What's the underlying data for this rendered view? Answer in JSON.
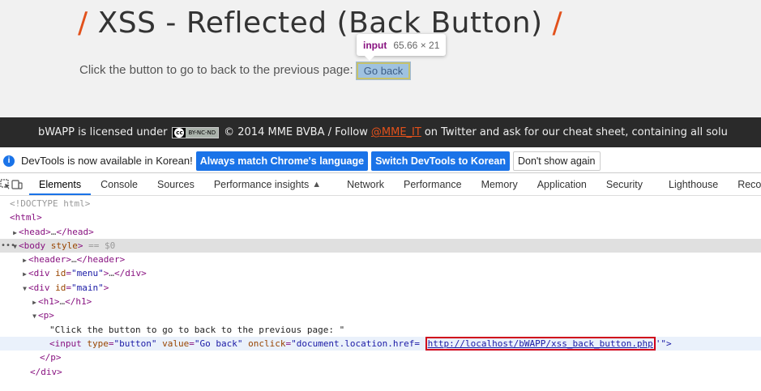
{
  "page": {
    "title": "XSS - Reflected (Back Button)",
    "title_slash": "/",
    "line_text": "Click the button to go to back to the previous page:",
    "button_label": "Go back",
    "tooltip": {
      "tag": "input",
      "dims": "65.66 × 21"
    }
  },
  "footer": {
    "prefix": "bWAPP is licensed under",
    "license": "BY-NC-ND",
    "license_cc": "cc",
    "middle": "© 2014 MME BVBA / Follow",
    "twitter": "@MME_IT",
    "suffix": "on Twitter and ask for our cheat sheet, containing all solu"
  },
  "notice": {
    "text": "DevTools is now available in Korean!",
    "btn_match": "Always match Chrome's language",
    "btn_switch": "Switch DevTools to Korean",
    "btn_dismiss": "Don't show again"
  },
  "tabs": [
    "Elements",
    "Console",
    "Sources",
    "Performance insights",
    "Network",
    "Performance",
    "Memory",
    "Application",
    "Security",
    "Lighthouse",
    "Recorde"
  ],
  "active_tab": "Elements",
  "tree": {
    "doctype": "<!DOCTYPE html>",
    "html": "<html>",
    "head_open": "<head>",
    "head_ellipsis": "…",
    "head_close": "</head>",
    "body_open": "<body",
    "body_attr": "style",
    "body_tail": ">",
    "body_eq": "== $0",
    "header_open": "<header>",
    "header_close": "</header>",
    "div_open": "<div",
    "attr_id": "id",
    "val_menu": "\"menu\"",
    "val_main": "\"main\"",
    "div_close": "</div>",
    "h1_open": "<h1>",
    "h1_close": "</h1>",
    "p_open": "<p>",
    "p_close": "</p>",
    "text_node": "\"Click the button to go to back to the previous page: \"",
    "input_open": "<input",
    "attr_type": "type",
    "val_type": "\"button\"",
    "attr_value": "value",
    "val_value": "\"Go back\"",
    "attr_onclick": "onclick",
    "val_onclick_pre": "\"document.location.href=",
    "val_url": "http://localhost/bWAPP/xss_back_button.php",
    "val_onclick_post": "'\">",
    "ellipsis": "…",
    "gt": ">",
    "eq": "="
  },
  "colors": {
    "accent": "#1a73e8",
    "title_slash": "#e2511b",
    "highlight_box": "#d0021b"
  }
}
